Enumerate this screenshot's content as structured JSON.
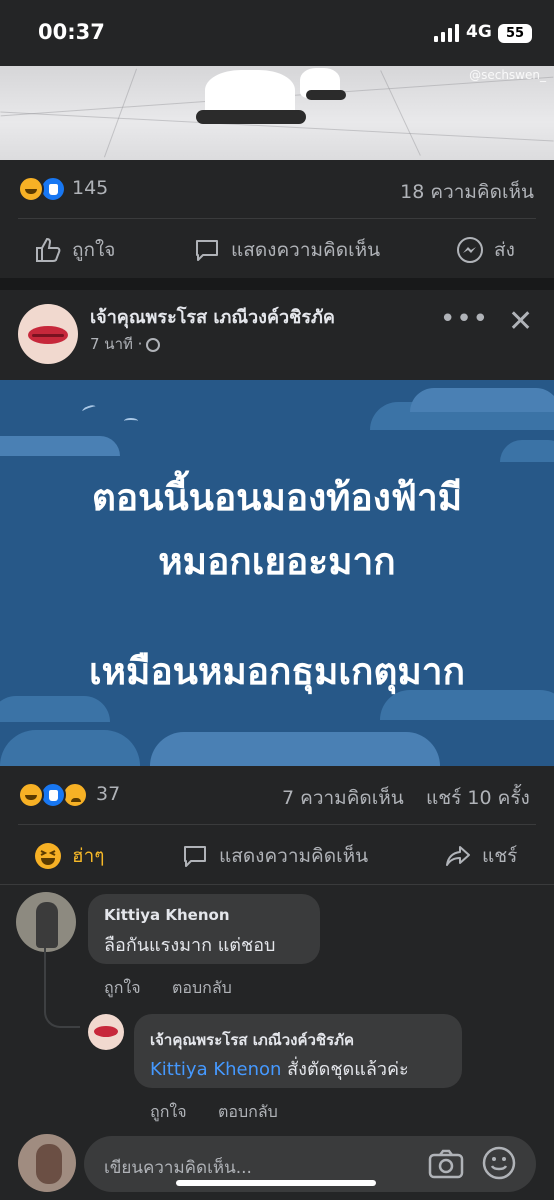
{
  "status_bar": {
    "time": "00:37",
    "network": "4G",
    "battery": "55"
  },
  "post1": {
    "watermark": "@sechswen_",
    "reaction_count": "145",
    "comments_count": "18 ความคิดเห็น",
    "actions": {
      "like": "ถูกใจ",
      "comment": "แสดงความคิดเห็น",
      "send": "ส่ง"
    }
  },
  "post2": {
    "author": "เจ้าคุณพระโรส เภณีวงค์วชิรภัค",
    "time": "7 นาที ·",
    "banner_lines": [
      "ตอนนี้นอนมองท้องฟ้ามี",
      "หมอกเยอะมาก",
      "เหมือนหมอกธุมเกตุมาก"
    ],
    "reaction_count": "37",
    "comments_count": "7 ความคิดเห็น",
    "shares_count": "แชร์ 10 ครั้ง",
    "actions": {
      "haha": "ฮ่าๆ",
      "comment": "แสดงความคิดเห็น",
      "share": "แชร์"
    }
  },
  "comments": [
    {
      "name": "Kittiya Khenon",
      "text": "ลือกันแรงมาก แต่ชอบ",
      "like": "ถูกใจ",
      "reply": "ตอบกลับ"
    },
    {
      "name": "เจ้าคุณพระโรส เภณีวงค์วชิรภัค",
      "mention": "Kittiya Khenon",
      "text": " สั่งตัดชุดแล้วค่ะ",
      "like": "ถูกใจ",
      "reply": "ตอบกลับ"
    }
  ],
  "composer": {
    "placeholder": "เขียนความคิดเห็น..."
  },
  "colors": {
    "background": "#18191a",
    "card": "#242526",
    "banner": "#275888",
    "link": "#4599ff"
  }
}
